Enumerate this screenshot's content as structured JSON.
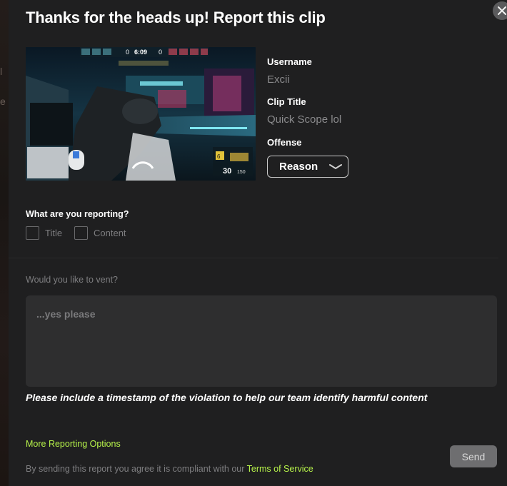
{
  "modal": {
    "title": "Thanks for the heads up! Report this clip",
    "close_icon": "close-icon"
  },
  "clip": {
    "thumbnail_icon": "video-thumbnail",
    "hud_timer": "6:09",
    "hud_score_left": "0",
    "hud_score_right": "0",
    "hud_ammo": "30",
    "hud_reserve": "150",
    "hud_gadget": "6"
  },
  "fields": {
    "username_label": "Username",
    "username_value": "Excii",
    "clip_title_label": "Clip Title",
    "clip_title_value": "Quick Scope lol",
    "offense_label": "Offense",
    "offense_select_value": "Reason",
    "offense_select_icon": "chevron-down-icon"
  },
  "reporting": {
    "label": "What are you reporting?",
    "options": [
      "Title",
      "Content"
    ]
  },
  "vent": {
    "label": "Would you like to vent?",
    "placeholder": "...yes please",
    "hint": "Please include a timestamp of the violation to help our team identify harmful content"
  },
  "footer": {
    "more_options": "More Reporting Options",
    "send_label": "Send",
    "legal_text": "By sending this report you agree it is compliant with our ",
    "tos_link": "Terms of Service"
  },
  "colors": {
    "accent": "#b6f24a",
    "background": "#1f1f20",
    "input_bg": "#2e2e2f",
    "send_bg": "#6e6e70"
  }
}
